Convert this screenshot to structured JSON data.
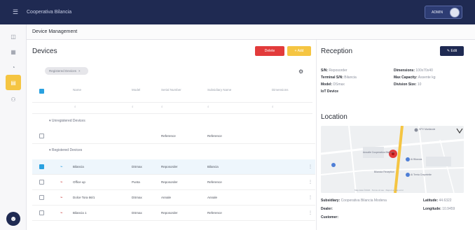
{
  "topbar": {
    "app_title": "Cooperativa Bilancia",
    "user_name": "ADMIN"
  },
  "breadcrumb": "Device Management",
  "devices": {
    "title": "Devices",
    "delete_label": "Delete",
    "add_label": "+ Add",
    "filter_chip": "Registered Devices"
  },
  "table": {
    "columns": [
      "Name",
      "Model",
      "Serial Number",
      "Subsidiary Name",
      "Dimensions"
    ],
    "groups": {
      "unregistered": "Unregistered Devices",
      "registered": "Registered Devices"
    },
    "unregistered_rows": [
      {
        "name": "",
        "model": "",
        "serial": "Reference",
        "subsidiary": "Reference"
      }
    ],
    "registered_rows": [
      {
        "name": "Bilancia",
        "model": "DSmax",
        "serial": "Reposorder",
        "subsidiary": "Bilancia",
        "selected": true
      },
      {
        "name": "Office up",
        "model": "Punta",
        "serial": "Reposorder",
        "subsidiary": "Reference",
        "selected": false
      },
      {
        "name": "Dolce Tora 66/1",
        "model": "DSmax",
        "serial": "Annale",
        "subsidiary": "Annale",
        "selected": false
      },
      {
        "name": "Bilancia 1",
        "model": "DSmax",
        "serial": "Reposorder",
        "subsidiary": "Reference",
        "selected": false
      }
    ]
  },
  "reception": {
    "title": "Reception",
    "edit_label": "Edit",
    "fields": {
      "sn": {
        "label": "S/N:",
        "value": "Reposorder"
      },
      "terminal_sn": {
        "label": "Terminal S/N:",
        "value": "Bilancia"
      },
      "model": {
        "label": "Model:",
        "value": "DSmax"
      },
      "iot": {
        "label": "IoT Device",
        "value": ""
      },
      "dimensions": {
        "label": "Dimensions:",
        "value": "100x70x40"
      },
      "max_capacity": {
        "label": "Max Capacity:",
        "value": "Assente kg"
      },
      "division_size": {
        "label": "Division Size:",
        "value": "10"
      }
    }
  },
  "location": {
    "title": "Location",
    "map_labels": {
      "place_a": "Annalle Cooperativa Bilancia",
      "place_b": "SPV Marilande",
      "place_c": "Bilancia Reception",
      "place_d": "Ai Bilancia",
      "place_e": "Ai Terria Crepelette",
      "footer": "Map data ©2022 · Terms of use · Report a map error"
    },
    "fields": {
      "subsidiary": {
        "label": "Subsidiary:",
        "value": "Cooperativa Bilancia Modena"
      },
      "latitude": {
        "label": "Latitude:",
        "value": "44.6322"
      },
      "dealer": {
        "label": "Dealer:",
        "value": ""
      },
      "longitude": {
        "label": "Longitude:",
        "value": "10.9459"
      },
      "customer": {
        "label": "Customer:",
        "value": ""
      }
    }
  },
  "colors": {
    "primary": "#1f2a52",
    "accent": "#f5c542",
    "danger": "#e23b3b",
    "checkbox": "#2aa1e0"
  }
}
